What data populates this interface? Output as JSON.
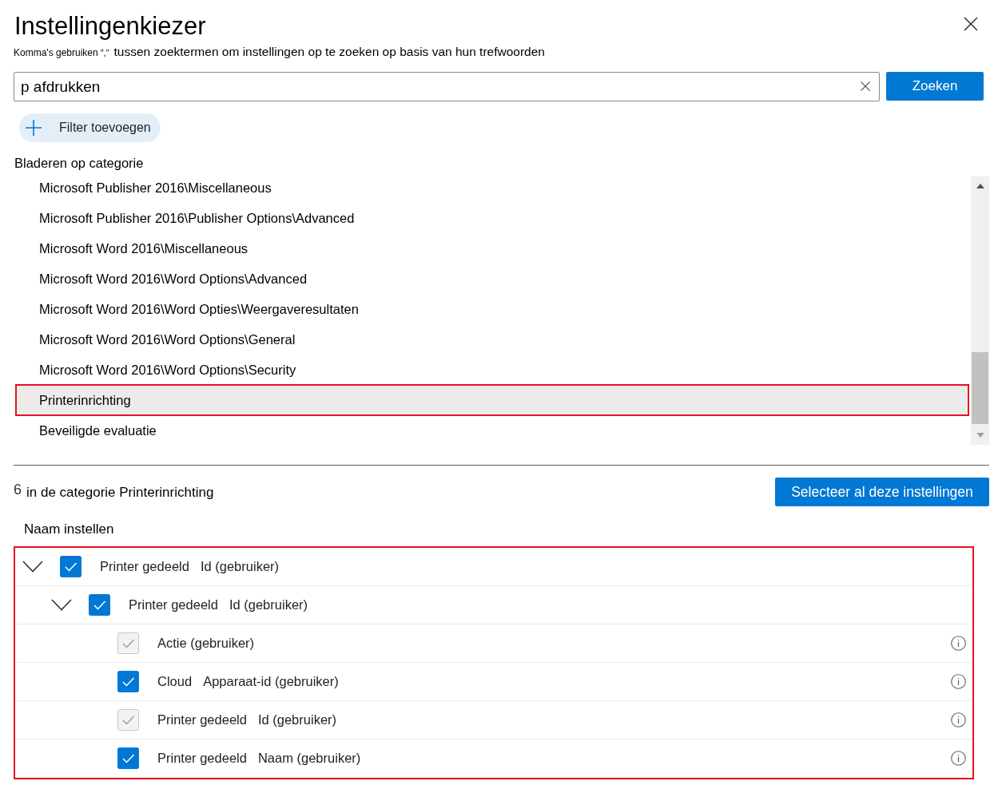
{
  "dialog": {
    "title": "Instellingenkiezer",
    "hint": {
      "prefix": "Komma's gebruiken",
      "marks": "\",\"",
      "text": "tussen zoektermen om instellingen op te zoeken op basis van hun trefwoorden"
    }
  },
  "search": {
    "value": "p afdrukken",
    "button": "Zoeken"
  },
  "filter_button": "Filter toevoegen",
  "categories": {
    "heading": "Bladeren op categorie",
    "items": [
      {
        "label": "Microsoft Publisher 2016\\Miscellaneous",
        "selected": false,
        "highlighted": false
      },
      {
        "label": "Microsoft Publisher 2016\\Publisher Options\\Advanced",
        "selected": false,
        "highlighted": false
      },
      {
        "label": "Microsoft Word 2016\\Miscellaneous",
        "selected": false,
        "highlighted": false
      },
      {
        "label": "Microsoft Word 2016\\Word Options\\Advanced",
        "selected": false,
        "highlighted": false
      },
      {
        "label": "Microsoft Word 2016\\Word Opties\\Weergaveresultaten",
        "selected": false,
        "highlighted": false
      },
      {
        "label": "Microsoft Word 2016\\Word Options\\General",
        "selected": false,
        "highlighted": false
      },
      {
        "label": "Microsoft Word 2016\\Word Options\\Security",
        "selected": false,
        "highlighted": false
      },
      {
        "label": "Printerinrichting",
        "selected": true,
        "highlighted": true
      },
      {
        "label": "Beveiligde evaluatie",
        "selected": false,
        "highlighted": false
      }
    ]
  },
  "results": {
    "count": "6",
    "caption": "in de categorie Printerinrichting",
    "select_all": "Selecteer al deze instellingen"
  },
  "settings": {
    "column": "Naam instellen",
    "highlighted": true,
    "rows": [
      {
        "parts": [
          "Printer gedeeld",
          "Id (gebruiker)"
        ],
        "checked": true,
        "disabled": false,
        "expanded": true,
        "children": [
          {
            "parts": [
              "Printer gedeeld",
              "Id (gebruiker)"
            ],
            "checked": true,
            "disabled": false,
            "expanded": true,
            "children": [
              {
                "parts": [
                  "Actie (gebruiker)"
                ],
                "checked": true,
                "disabled": true,
                "info": true
              },
              {
                "parts": [
                  "Cloud",
                  "Apparaat-id (gebruiker)"
                ],
                "checked": true,
                "disabled": false,
                "info": true
              },
              {
                "parts": [
                  "Printer gedeeld",
                  "Id (gebruiker)"
                ],
                "checked": true,
                "disabled": true,
                "info": true
              },
              {
                "parts": [
                  "Printer gedeeld",
                  "Naam (gebruiker)"
                ],
                "checked": true,
                "disabled": false,
                "info": true
              }
            ]
          }
        ]
      }
    ]
  }
}
